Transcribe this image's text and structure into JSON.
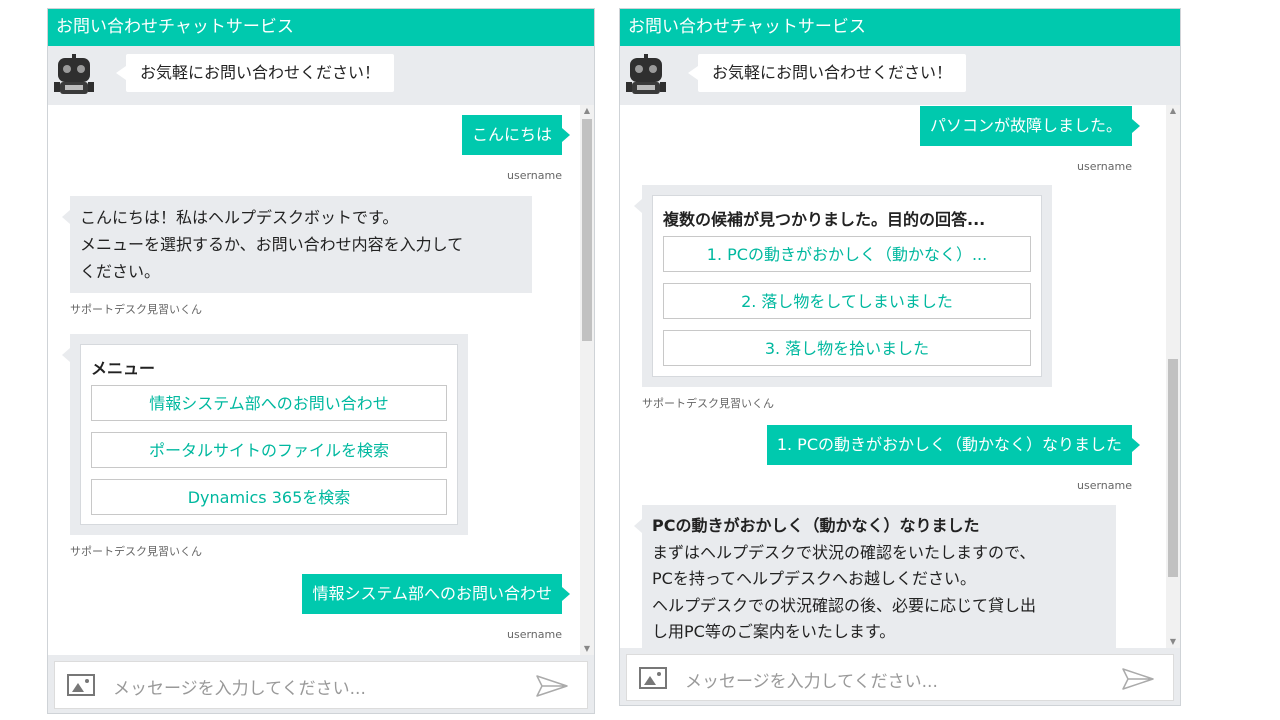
{
  "left_panel": {
    "title": "お問い合わせチャットサービス",
    "greeting": "お気軽にお問い合わせください！",
    "messages": {
      "user1": "こんにちは",
      "user1_meta": "username",
      "bot1_line1": "こんにちは！私はヘルプデスクボットです。",
      "bot1_line2": "メニューを選択するか、お問い合わせ内容を入力して",
      "bot1_line3": "ください。",
      "bot1_meta": "サポートデスク見習いくん",
      "menu_title": "メニュー",
      "menu_options": [
        "情報システム部へのお問い合わせ",
        "ポータルサイトのファイルを検索",
        "Dynamics 365を検索"
      ],
      "menu_meta": "サポートデスク見習いくん",
      "user2": "情報システム部へのお問い合わせ",
      "user2_meta": "username"
    },
    "input_placeholder": "メッセージを入力してください..."
  },
  "right_panel": {
    "title": "お問い合わせチャットサービス",
    "greeting": "お気軽にお問い合わせください！",
    "messages": {
      "user1": "パソコンが故障しました。",
      "user1_meta": "username",
      "candidates_title": "複数の候補が見つかりました。目的の回答...",
      "candidate_options": [
        "1. PCの動きがおかしく（動かなく）...",
        "2. 落し物をしてしまいました",
        "3. 落し物を拾いました"
      ],
      "candidates_meta": "サポートデスク見習いくん",
      "user2": "1. PCの動きがおかしく（動かなく）なりました",
      "user2_meta": "username",
      "bot_answer_title": "PCの動きがおかしく（動かなく）なりました",
      "bot_answer_line1": "まずはヘルプデスクで状況の確認をいたしますので、",
      "bot_answer_line2": "PCを持ってヘルプデスクへお越しください。",
      "bot_answer_line3": "ヘルプデスクでの状況確認の後、必要に応じて貸し出",
      "bot_answer_line4": "し用PC等のご案内をいたします。"
    },
    "input_placeholder": "メッセージを入力してください..."
  },
  "colors": {
    "accent": "#00c9ae",
    "bot_bubble": "#e9ebee",
    "option_text": "#00b89f"
  },
  "icons": [
    "robot-avatar-icon",
    "image-upload-icon",
    "send-icon",
    "scroll-up-icon",
    "scroll-down-icon"
  ]
}
